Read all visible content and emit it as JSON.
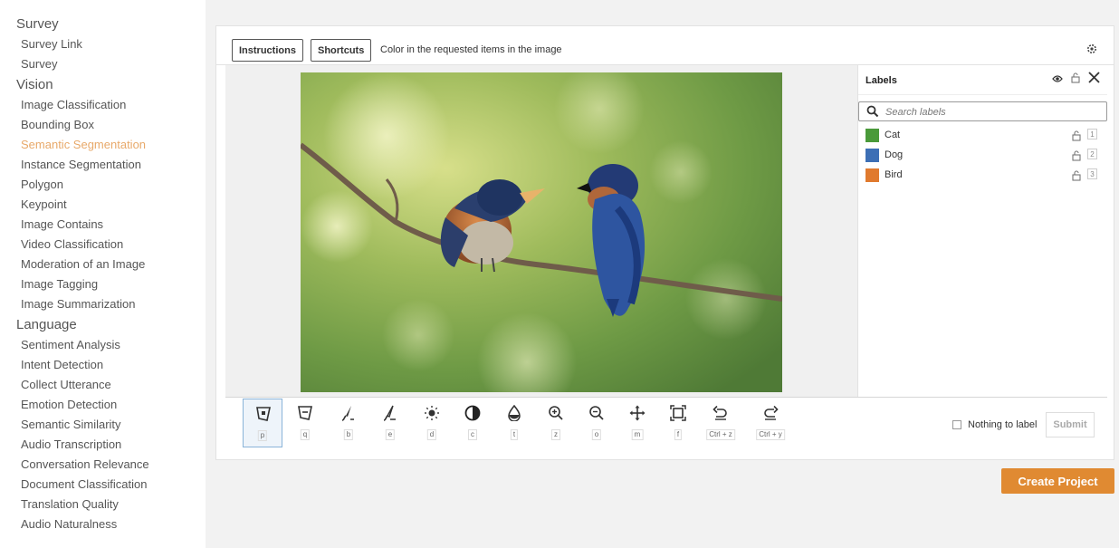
{
  "sidebar": {
    "sections": [
      {
        "title": "Survey",
        "items": [
          {
            "label": "Survey Link"
          },
          {
            "label": "Survey"
          }
        ]
      },
      {
        "title": "Vision",
        "items": [
          {
            "label": "Image Classification"
          },
          {
            "label": "Bounding Box"
          },
          {
            "label": "Semantic Segmentation",
            "active": true
          },
          {
            "label": "Instance Segmentation"
          },
          {
            "label": "Polygon"
          },
          {
            "label": "Keypoint"
          },
          {
            "label": "Image Contains"
          },
          {
            "label": "Video Classification"
          },
          {
            "label": "Moderation of an Image"
          },
          {
            "label": "Image Tagging"
          },
          {
            "label": "Image Summarization"
          }
        ]
      },
      {
        "title": "Language",
        "items": [
          {
            "label": "Sentiment Analysis"
          },
          {
            "label": "Intent Detection"
          },
          {
            "label": "Collect Utterance"
          },
          {
            "label": "Emotion Detection"
          },
          {
            "label": "Semantic Similarity"
          },
          {
            "label": "Audio Transcription"
          },
          {
            "label": "Conversation Relevance"
          },
          {
            "label": "Document Classification"
          },
          {
            "label": "Translation Quality"
          },
          {
            "label": "Audio Naturalness"
          }
        ]
      }
    ]
  },
  "topbar": {
    "instructions_label": "Instructions",
    "shortcuts_label": "Shortcuts",
    "instruction_text": "Color in the requested items in the image"
  },
  "labels_panel": {
    "title": "Labels",
    "search_placeholder": "Search labels",
    "labels": [
      {
        "name": "Cat",
        "color": "#4a9a3a",
        "key": "1"
      },
      {
        "name": "Dog",
        "color": "#3d6fb5",
        "key": "2"
      },
      {
        "name": "Bird",
        "color": "#e07a2e",
        "key": "3"
      }
    ]
  },
  "toolbar": {
    "tools": [
      {
        "icon": "polygon-select-icon",
        "key": "p",
        "active": true
      },
      {
        "icon": "polygon-remove-icon",
        "key": "q"
      },
      {
        "icon": "brush-icon",
        "key": "b"
      },
      {
        "icon": "eraser-icon",
        "key": "e"
      },
      {
        "icon": "brightness-icon",
        "key": "d"
      },
      {
        "icon": "contrast-icon",
        "key": "c"
      },
      {
        "icon": "transparency-icon",
        "key": "t"
      },
      {
        "icon": "zoom-in-icon",
        "key": "z"
      },
      {
        "icon": "zoom-out-icon",
        "key": "o"
      },
      {
        "icon": "move-icon",
        "key": "m"
      },
      {
        "icon": "fit-icon",
        "key": "f"
      },
      {
        "icon": "undo-icon",
        "key": "Ctrl + z"
      },
      {
        "icon": "redo-icon",
        "key": "Ctrl + y"
      }
    ],
    "nothing_to_label": "Nothing to label",
    "submit_label": "Submit"
  },
  "create_project_label": "Create Project",
  "colors": {
    "accent": "#e08a32",
    "active_nav": "#e8a96a"
  }
}
